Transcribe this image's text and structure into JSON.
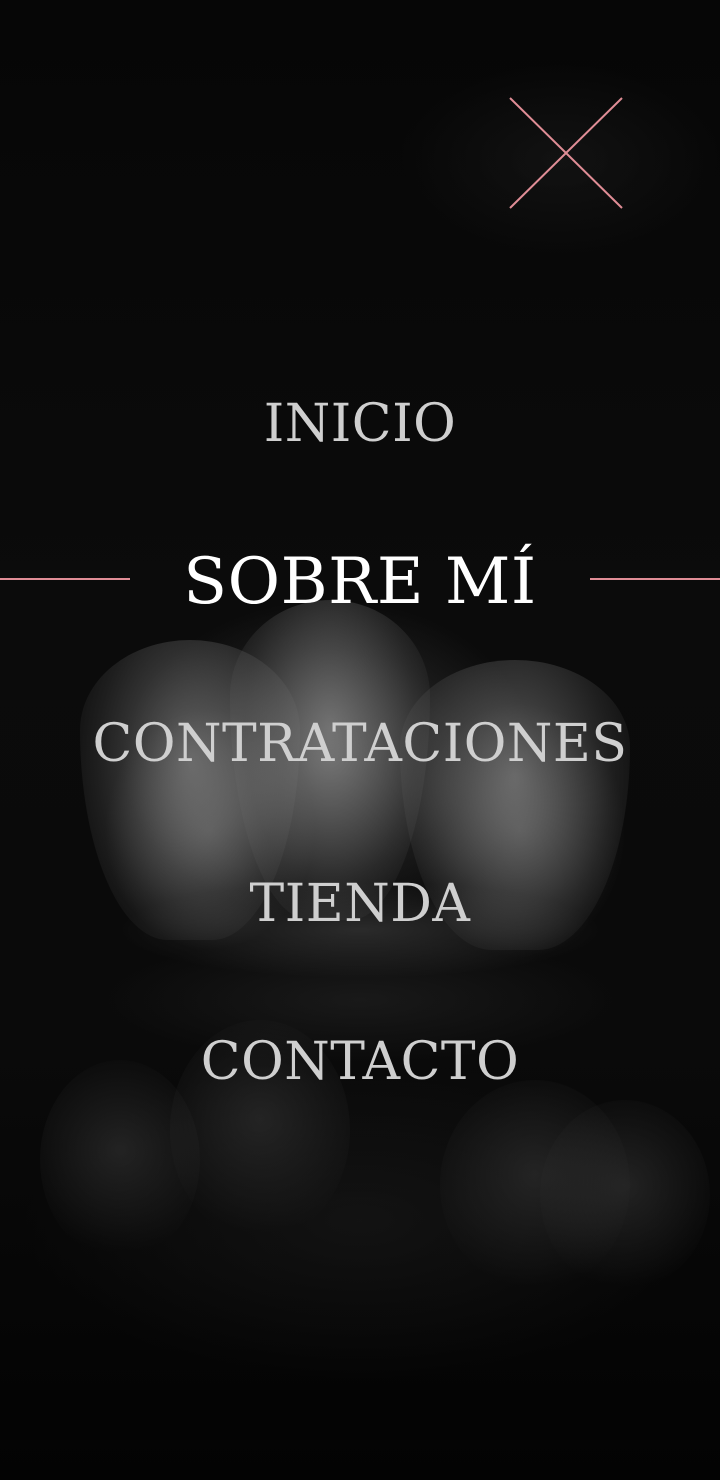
{
  "menu": {
    "items": [
      {
        "label": "INICIO",
        "active": false
      },
      {
        "label": "SOBRE MÍ",
        "active": true
      },
      {
        "label": "CONTRATACIONES",
        "active": false
      },
      {
        "label": "TIENDA",
        "active": false
      },
      {
        "label": "CONTACTO",
        "active": false
      }
    ]
  },
  "close_button": {
    "icon": "close-icon"
  },
  "colors": {
    "accent": "#e08d96",
    "background": "#050505",
    "text": "#cfcfcf",
    "active_text": "#ffffff"
  }
}
